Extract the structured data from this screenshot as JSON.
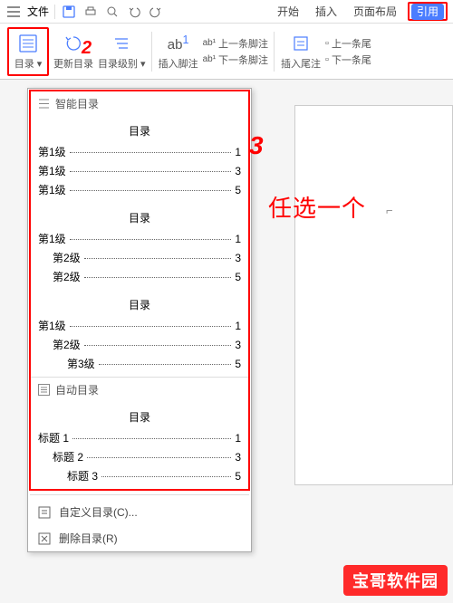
{
  "menubar": {
    "file": "文件",
    "tabs": {
      "start": "开始",
      "insert": "插入",
      "layout": "页面布局",
      "reference": "引用"
    }
  },
  "toolbar": {
    "toc": "目录",
    "update_toc": "更新目录",
    "toc_level": "目录级别",
    "insert_footnote": "插入脚注",
    "prev_footnote": "上一条脚注",
    "next_footnote": "下一条脚注",
    "insert_endnote": "插入尾注",
    "prev_endnote": "上一条尾",
    "next_endnote": "下一条尾"
  },
  "dropdown": {
    "smart_header": "智能目录",
    "auto_header": "自动目录",
    "custom": "自定义目录(C)...",
    "delete": "删除目录(R)",
    "toc_label": "目录",
    "previews": [
      {
        "lines": [
          {
            "label": "第1级",
            "page": "1",
            "indent": 0
          },
          {
            "label": "第1级",
            "page": "3",
            "indent": 0
          },
          {
            "label": "第1级",
            "page": "5",
            "indent": 0
          }
        ]
      },
      {
        "lines": [
          {
            "label": "第1级",
            "page": "1",
            "indent": 0
          },
          {
            "label": "第2级",
            "page": "3",
            "indent": 1
          },
          {
            "label": "第2级",
            "page": "5",
            "indent": 1
          }
        ]
      },
      {
        "lines": [
          {
            "label": "第1级",
            "page": "1",
            "indent": 0
          },
          {
            "label": "第2级",
            "page": "3",
            "indent": 1
          },
          {
            "label": "第3级",
            "page": "5",
            "indent": 2
          }
        ]
      }
    ],
    "auto_preview": {
      "lines": [
        {
          "label": "标题 1",
          "page": "1",
          "indent": 0
        },
        {
          "label": "标题 2",
          "page": "3",
          "indent": 1
        },
        {
          "label": "标题 3",
          "page": "5",
          "indent": 2
        }
      ]
    }
  },
  "annotations": {
    "num2": "2",
    "num3": "3",
    "pick_one": "任选一个"
  },
  "watermark": "宝哥软件园"
}
